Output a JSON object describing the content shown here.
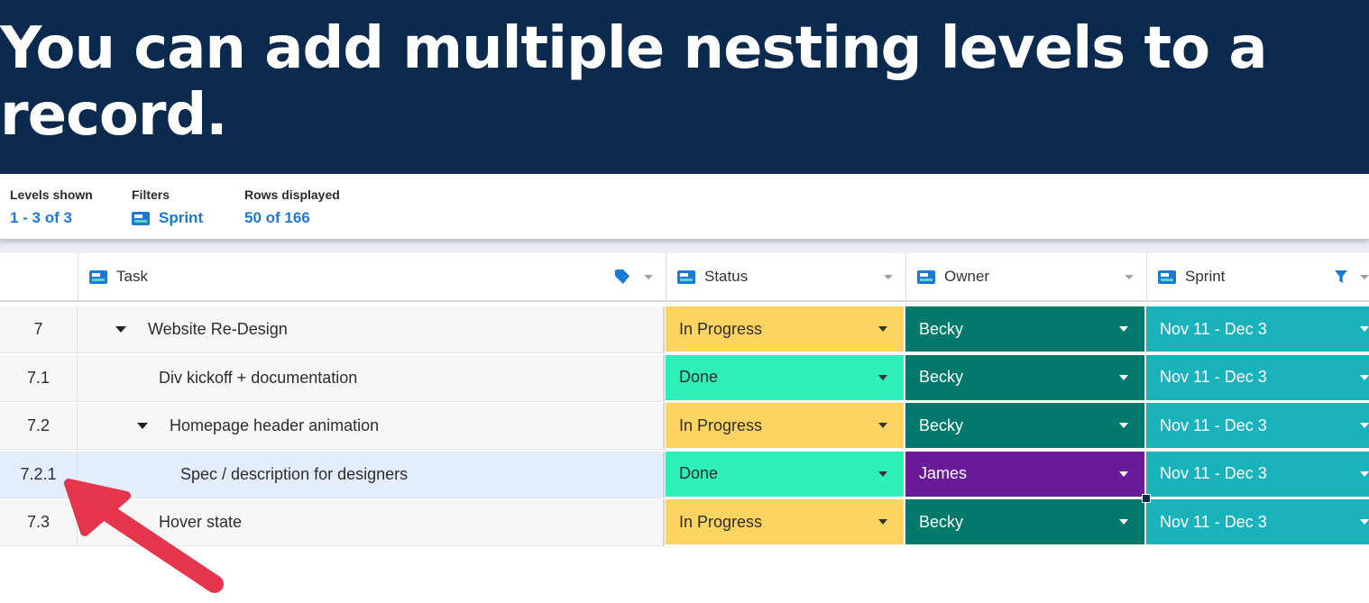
{
  "banner": {
    "title": "You can add multiple nesting levels to a record."
  },
  "toolbar": {
    "levels": {
      "label": "Levels shown",
      "value": "1 - 3 of 3"
    },
    "filters": {
      "label": "Filters",
      "value": "Sprint",
      "icon": "column-icon"
    },
    "rows": {
      "label": "Rows displayed",
      "value": "50 of 166"
    }
  },
  "columns": {
    "task": {
      "label": "Task",
      "icon": "column-icon",
      "extra_icon": "tag-icon"
    },
    "status": {
      "label": "Status",
      "icon": "column-icon"
    },
    "owner": {
      "label": "Owner",
      "icon": "column-icon"
    },
    "sprint": {
      "label": "Sprint",
      "icon": "column-icon",
      "extra_icon": "filter-icon"
    }
  },
  "rows": [
    {
      "num": "7",
      "task": "Website Re-Design",
      "level": 1,
      "expandable": true,
      "status": "In Progress",
      "owner": "Becky",
      "sprint": "Nov 11 - Dec 3"
    },
    {
      "num": "7.1",
      "task": "Div kickoff + documentation",
      "level": 2,
      "expandable": false,
      "status": "Done",
      "owner": "Becky",
      "sprint": "Nov 11 - Dec 3"
    },
    {
      "num": "7.2",
      "task": "Homepage header animation",
      "level": 2,
      "expandable": true,
      "status": "In Progress",
      "owner": "Becky",
      "sprint": "Nov 11 - Dec 3"
    },
    {
      "num": "7.2.1",
      "task": "Spec / description for designers",
      "level": 3,
      "expandable": false,
      "status": "Done",
      "owner": "James",
      "sprint": "Nov 11 - Dec 3",
      "selected": true
    },
    {
      "num": "7.3",
      "task": "Hover state",
      "level": 2,
      "expandable": false,
      "status": "In Progress",
      "owner": "Becky",
      "sprint": "Nov 11 - Dec 3"
    }
  ],
  "colors": {
    "banner": "#0b2a4e",
    "accent": "#1a7ad4",
    "status_in_progress": "#fdd462",
    "status_done": "#2fefb8",
    "owner_becky": "#02796b",
    "owner_james": "#6a1b9a",
    "sprint": "#1ab3bb",
    "arrow": "#e5344d",
    "selected_row": "#e3eefa"
  }
}
